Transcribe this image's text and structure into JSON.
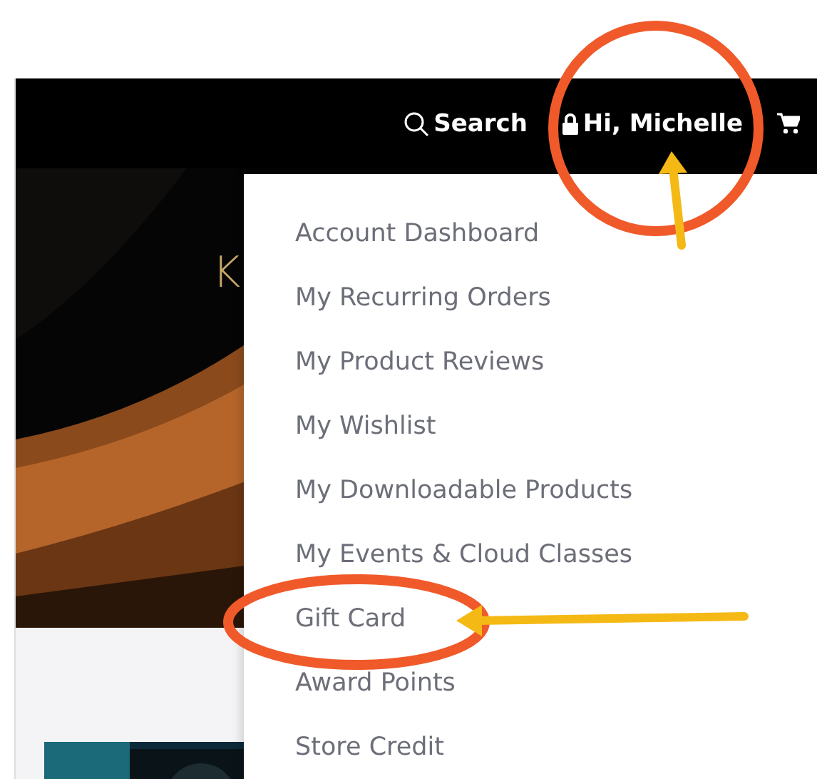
{
  "header": {
    "search": "Search",
    "account": "Hi, Michelle"
  },
  "hero": {
    "text": "K"
  },
  "account_menu": {
    "items": [
      {
        "label": "Account Dashboard"
      },
      {
        "label": "My Recurring Orders"
      },
      {
        "label": "My Product Reviews"
      },
      {
        "label": "My Wishlist"
      },
      {
        "label": "My Downloadable Products"
      },
      {
        "label": "My Events & Cloud Classes"
      },
      {
        "label": "Gift Card"
      },
      {
        "label": "Award Points"
      },
      {
        "label": "Store Credit"
      }
    ]
  }
}
